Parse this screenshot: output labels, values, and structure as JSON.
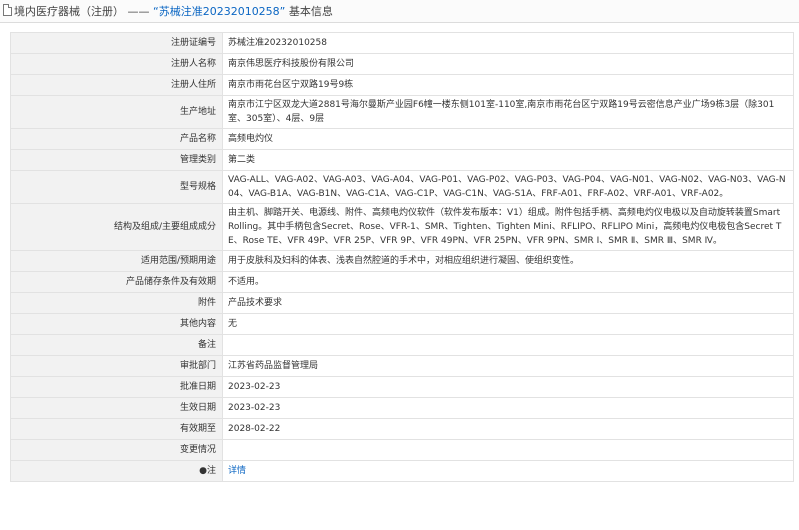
{
  "header": {
    "icon": "document-icon",
    "prefix": "境内医疗器械（注册）",
    "separator": " —— ",
    "reg_quote": "“苏械注准20232010258”",
    "suffix": " 基本信息"
  },
  "rows": [
    {
      "label": "注册证编号",
      "value": "苏械注准20232010258"
    },
    {
      "label": "注册人名称",
      "value": "南京伟思医疗科技股份有限公司"
    },
    {
      "label": "注册人住所",
      "value": "南京市雨花台区宁双路19号9栋"
    },
    {
      "label": "生产地址",
      "value": "南京市江宁区双龙大道2881号海尔曼斯产业园F6幢一楼东侧101室-110室,南京市雨花台区宁双路19号云密信息产业广场9栋3层（除301室、305室）、4层、9层"
    },
    {
      "label": "产品名称",
      "value": "高频电灼仪"
    },
    {
      "label": "管理类别",
      "value": "第二类"
    },
    {
      "label": "型号规格",
      "value": "VAG-ALL、VAG-A02、VAG-A03、VAG-A04、VAG-P01、VAG-P02、VAG-P03、VAG-P04、VAG-N01、VAG-N02、VAG-N03、VAG-N04、VAG-B1A、VAG-B1N、VAG-C1A、VAG-C1P、VAG-C1N、VAG-S1A、FRF-A01、FRF-A02、VRF-A01、VRF-A02。"
    },
    {
      "label": "结构及组成/主要组成成分",
      "value": "由主机、脚踏开关、电源线、附件、高频电灼仪软件（软件发布版本：V1）组成。附件包括手柄、高频电灼仪电极以及自动旋转装置Smart Rolling。其中手柄包含Secret、Rose、VFR-1、SMR、Tighten、Tighten Mini、RFLIPO、RFLIPO Mini，高频电灼仪电极包含Secret TE、Rose TE、VFR 49P、VFR 25P、VFR 9P、VFR 49PN、VFR 25PN、VFR 9PN、SMR Ⅰ、SMR Ⅱ、SMR Ⅲ、SMR Ⅳ。"
    },
    {
      "label": "适用范围/预期用途",
      "value": "用于皮肤科及妇科的体表、浅表自然腔道的手术中，对相应组织进行凝固、使组织变性。"
    },
    {
      "label": "产品储存条件及有效期",
      "value": "不适用。"
    },
    {
      "label": "附件",
      "value": "产品技术要求"
    },
    {
      "label": "其他内容",
      "value": "无"
    },
    {
      "label": "备注",
      "value": ""
    },
    {
      "label": "审批部门",
      "value": "江苏省药品监督管理局"
    },
    {
      "label": "批准日期",
      "value": "2023-02-23"
    },
    {
      "label": "生效日期",
      "value": "2023-02-23"
    },
    {
      "label": "有效期至",
      "value": "2028-02-22"
    },
    {
      "label": "变更情况",
      "value": ""
    },
    {
      "label": "注",
      "value": "详情",
      "prefix_mark": "●"
    }
  ]
}
